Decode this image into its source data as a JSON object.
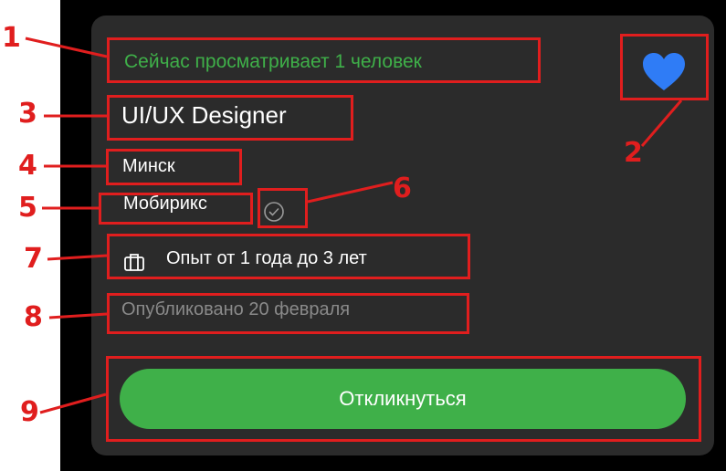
{
  "vacancy": {
    "viewers_text": "Сейчас просматривает 1 человек",
    "title": "UI/UX Designer",
    "city": "Минск",
    "company": "Мобирикс",
    "experience": "Опыт от 1 года до 3 лет",
    "published": "Опубликовано 20 февраля",
    "apply_label": "Откликнуться"
  },
  "icons": {
    "favorite": "heart-icon",
    "verified": "check-circle-icon",
    "experience": "briefcase-icon"
  },
  "annotations": {
    "labels": [
      "1",
      "2",
      "3",
      "4",
      "5",
      "6",
      "7",
      "8",
      "9"
    ]
  },
  "colors": {
    "accent_green": "#3fb049",
    "heart_blue": "#2f7cf6",
    "card_bg": "#2b2b2b",
    "annotation_red": "#e01e1e"
  }
}
